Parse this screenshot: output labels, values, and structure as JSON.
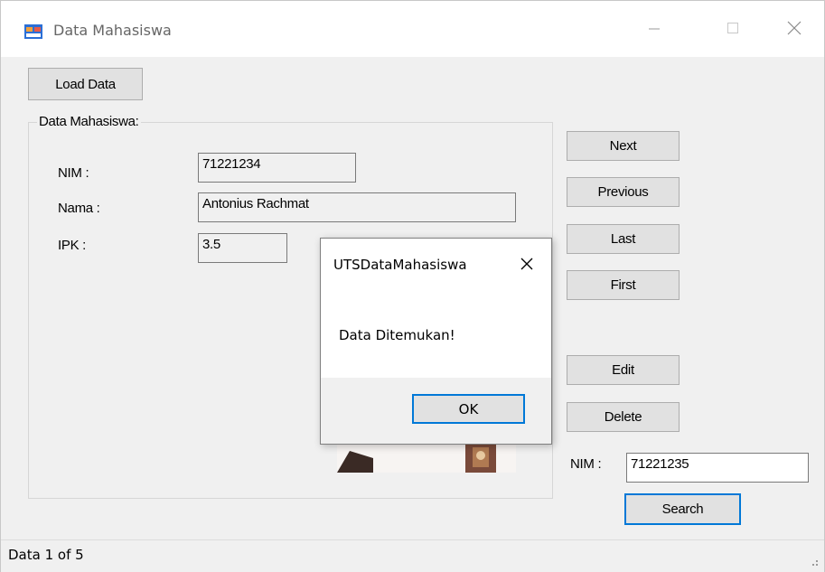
{
  "window": {
    "title": "Data Mahasiswa",
    "icon": "app-form-icon"
  },
  "toolbar": {
    "load_label": "Load Data"
  },
  "group": {
    "legend": "Data Mahasiswa:",
    "nim_label": "NIM :",
    "nim_value": "71221234",
    "nama_label": "Nama :",
    "nama_value": "Antonius Rachmat",
    "ipk_label": "IPK :",
    "ipk_value": "3.5"
  },
  "nav": {
    "next": "Next",
    "previous": "Previous",
    "last": "Last",
    "first": "First",
    "edit": "Edit",
    "delete": "Delete"
  },
  "search": {
    "label": "NIM :",
    "value": "71221235",
    "button": "Search"
  },
  "status": {
    "text": "Data  1 of 5"
  },
  "dialog": {
    "title": "UTSDataMahasiswa",
    "message": "Data Ditemukan!",
    "ok": "OK"
  },
  "colors": {
    "accent": "#0078d7",
    "button_face": "#e1e1e1",
    "form_back": "#f0f0f0"
  }
}
